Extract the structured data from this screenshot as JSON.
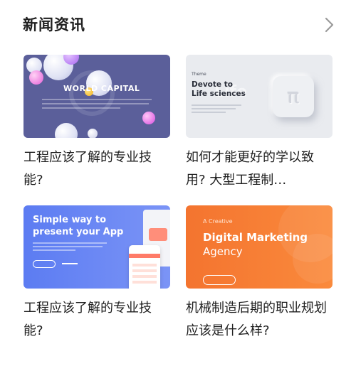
{
  "header": {
    "title": "新闻资讯"
  },
  "cards": [
    {
      "title": "工程应该了解的专业技能?",
      "thumb": {
        "headline": "WORLD CAPITAL"
      }
    },
    {
      "title": "如何才能更好的学以致用? 大型工程制…",
      "thumb": {
        "small": "Theme",
        "headline_line1": "Devote to",
        "headline_line2": "Life sciences",
        "ghost": "Life",
        "symbol": "π"
      }
    },
    {
      "title": "工程应该了解的专业技能?",
      "thumb": {
        "headline_line1": "Simple way to",
        "headline_line2": "present your App"
      }
    },
    {
      "title": "机械制造后期的职业规划应该是什么样?",
      "thumb": {
        "pre": "A Creative",
        "headline_line1": "Digital Marketing",
        "headline_line2": "Agency"
      }
    }
  ],
  "icons": {
    "more": "chevron-right-icon"
  },
  "colors": {
    "accent_orange": "#f4742f",
    "accent_blue": "#5c7cf2",
    "accent_indigo": "#5b5f9a"
  }
}
